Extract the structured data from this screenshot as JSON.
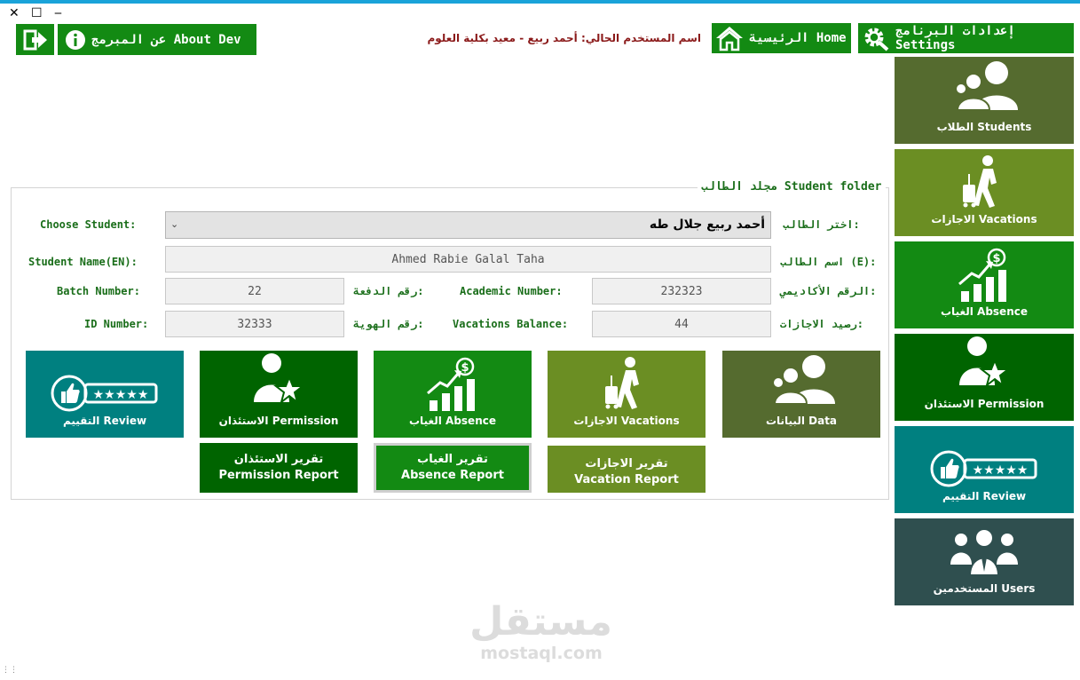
{
  "window": {
    "close": "✕",
    "maximize": "☐",
    "minimize": "‒"
  },
  "header": {
    "about_label": "عن المبرمج About Dev",
    "user_text": "اسم المستخدم الحالي: أحمد ربيع - معيد بكلية العلوم",
    "home_label": "الرئيسية Home",
    "settings_label": "إعدادات البرنامج Settings"
  },
  "sidebar": {
    "items": [
      {
        "label": "الطلاب Students",
        "icon": "users-group-icon",
        "color": "#556b2f"
      },
      {
        "label": "الاجازات Vacations",
        "icon": "traveler-icon",
        "color": "#6b8e23"
      },
      {
        "label": "الغياب Absence",
        "icon": "growth-chart-icon",
        "color": "#138a13"
      },
      {
        "label": "الاستئذان Permission",
        "icon": "user-star-icon",
        "color": "#006400"
      },
      {
        "label": "التقييم Review",
        "icon": "thumbs-up-rating-icon",
        "color": "#008080"
      },
      {
        "label": "المستخدمين Users",
        "icon": "business-users-icon",
        "color": "#2f4f4f"
      }
    ]
  },
  "panel": {
    "title": "مجلد الطالب Student folder",
    "choose_en": "Choose Student:",
    "choose_ar": "اختر الطالب:",
    "selected_student": "أحمد ربيع جلال طه",
    "name_en_label": "Student Name(EN):",
    "name_ar_label": "اسم الطالب (E):",
    "name_value": "Ahmed Rabie Galal Taha",
    "batch_label": "Batch Number:",
    "batch_ar": "رقم الدفعة:",
    "batch_value": "22",
    "academic_label": "Academic Number:",
    "academic_ar": "الرقم الأكاديمي:",
    "academic_value": "232323",
    "id_label": "ID Number:",
    "id_ar": "رقم الهوية:",
    "id_value": "32333",
    "vac_label": "Vacations Balance:",
    "vac_ar": "رصيد الاجازات:",
    "vac_value": "44"
  },
  "actions": [
    {
      "label": "التقييم Review",
      "color": "#008080"
    },
    {
      "label": "الاستئذان Permission",
      "color": "#006400"
    },
    {
      "label": "الغياب Absence",
      "color": "#138a13"
    },
    {
      "label": "الاجازات Vacations",
      "color": "#6b8e23"
    },
    {
      "label": "البيانات Data",
      "color": "#556b2f"
    }
  ],
  "reports": [
    {
      "line1": "تقرير الاستئذان",
      "line2": "Permission Report"
    },
    {
      "line1": "تقرير الغياب",
      "line2": "Absence Report"
    },
    {
      "line1": "تقرير الاجازات",
      "line2": "Vacation Report"
    }
  ],
  "watermark": {
    "arabic": "مستقل",
    "latin": "mostaql.com"
  },
  "colors": {
    "accent": "#138a13",
    "title_text": "#1a6e1a",
    "user_text": "#8b1a1a",
    "topline": "#1aa3d9"
  }
}
